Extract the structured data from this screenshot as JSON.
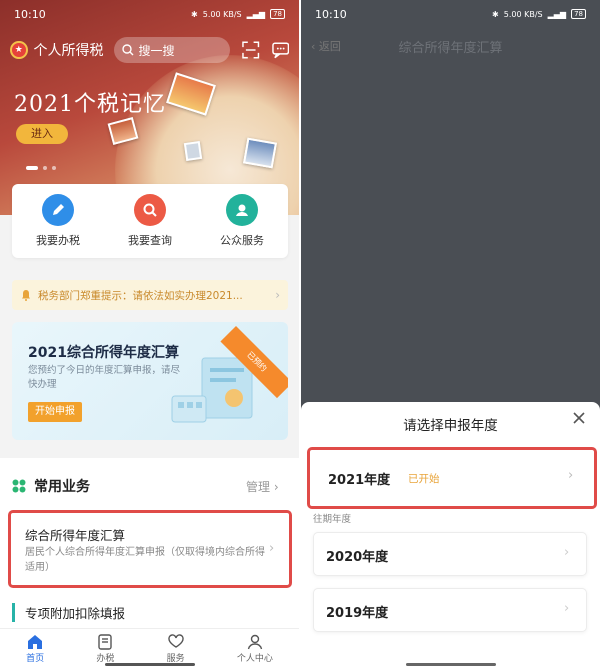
{
  "status_bar": {
    "time": "10:10",
    "network_speed": "5.00 KB/S",
    "battery": "78"
  },
  "left": {
    "app_title": "个人所得税",
    "search": {
      "placeholder": "搜一搜"
    },
    "banner": {
      "title": "2021个税记忆",
      "enter_label": "进入"
    },
    "quick_actions": [
      {
        "label": "我要办税",
        "icon": "pen-icon",
        "color": "#2f8ee8"
      },
      {
        "label": "我要查询",
        "icon": "search-icon",
        "color": "#ec5a45"
      },
      {
        "label": "公众服务",
        "icon": "service-icon",
        "color": "#22b29b"
      }
    ],
    "notice": {
      "text": "税务部门郑重提示：请依法如实办理2021..."
    },
    "promo": {
      "title": "2021综合所得年度汇算",
      "desc": "您预约了今日的年度汇算申报，请尽快办理",
      "button": "开始申报",
      "ribbon": "已预约"
    },
    "common": {
      "title": "常用业务",
      "manage": "管理",
      "items": [
        {
          "title": "综合所得年度汇算",
          "desc": "居民个人综合所得年度汇算申报（仅取得境内综合所得适用）"
        },
        {
          "title": "专项附加扣除填报"
        }
      ]
    },
    "tabs": [
      {
        "label": "首页",
        "icon": "home-icon"
      },
      {
        "label": "办税",
        "icon": "document-icon"
      },
      {
        "label": "服务",
        "icon": "heart-hand-icon"
      },
      {
        "label": "个人中心",
        "icon": "person-icon"
      }
    ]
  },
  "right": {
    "back_label": "返回",
    "title": "综合所得年度汇算",
    "sheet": {
      "title": "请选择申报年度",
      "current": {
        "year": "2021年度",
        "badge": "已开始"
      },
      "past_label": "往期年度",
      "past": [
        {
          "year": "2020年度"
        },
        {
          "year": "2019年度"
        }
      ]
    }
  },
  "colors": {
    "accent_red": "#e04b48",
    "brand_orange": "#f2a12c",
    "tab_active": "#2a6fe0"
  }
}
